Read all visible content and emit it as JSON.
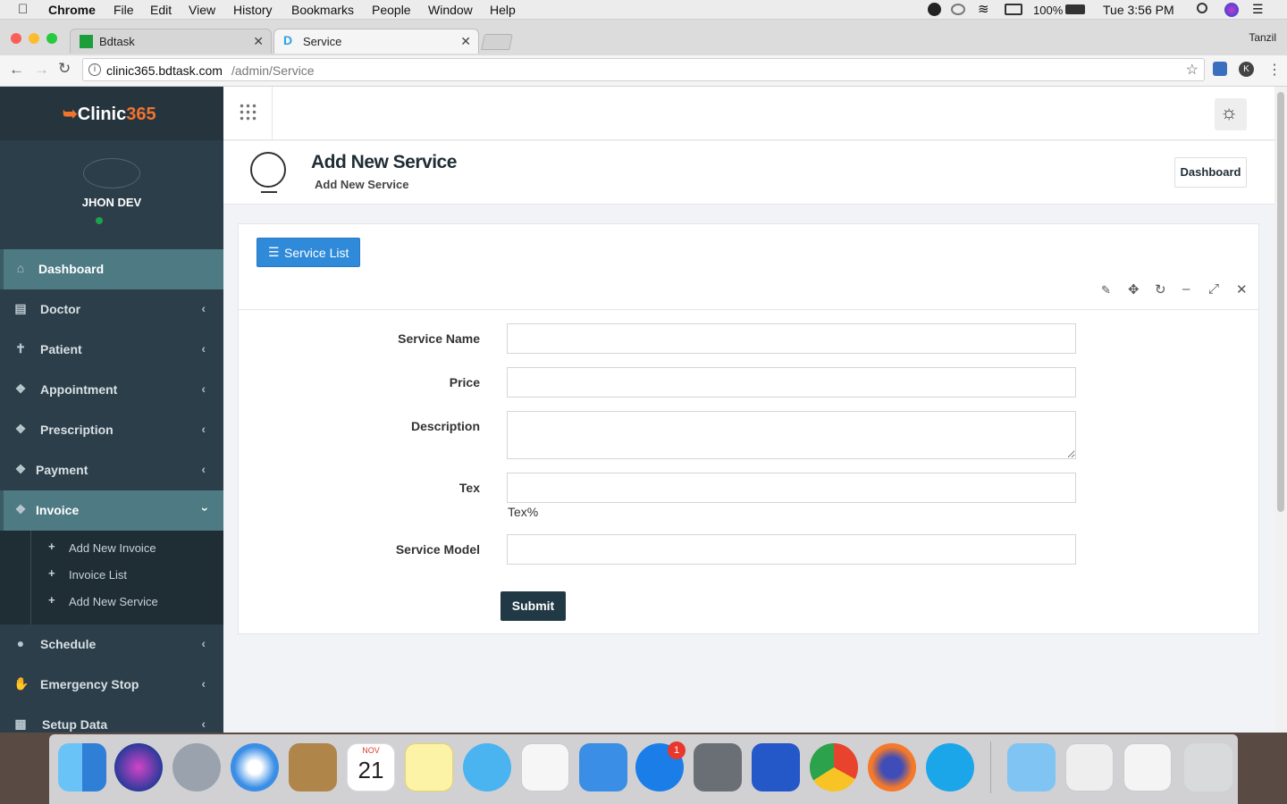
{
  "menubar": {
    "app": "Chrome",
    "items": [
      "File",
      "Edit",
      "View",
      "History",
      "Bookmarks",
      "People",
      "Window",
      "Help"
    ],
    "battery": "100%",
    "clock": "Tue 3:56 PM"
  },
  "browser": {
    "tabs": [
      {
        "title": "Bdtask"
      },
      {
        "title": "Service"
      }
    ],
    "profile_name": "Tanzil",
    "url_host": "clinic365.bdtask.com",
    "url_path": "/admin/Service"
  },
  "sidebar": {
    "logo_text_a": "Clinic",
    "logo_text_b": "365",
    "user_name": "JHON DEV",
    "items": [
      {
        "label": "Dashboard"
      },
      {
        "label": "Doctor"
      },
      {
        "label": "Patient"
      },
      {
        "label": "Appointment"
      },
      {
        "label": "Prescription"
      },
      {
        "label": "Payment"
      },
      {
        "label": "Invoice"
      },
      {
        "label": "Schedule"
      },
      {
        "label": "Emergency Stop"
      },
      {
        "label": "Setup Data"
      }
    ],
    "invoice_sub": [
      {
        "label": "Add New Invoice"
      },
      {
        "label": "Invoice List"
      },
      {
        "label": "Add New Service"
      }
    ]
  },
  "page": {
    "title": "Add New Service",
    "subtitle": "Add New Service",
    "breadcrumb": "Dashboard"
  },
  "panel": {
    "service_list_button": "Service List",
    "tools": [
      "pencil-icon",
      "move-icon",
      "refresh-icon",
      "minimize-icon",
      "expand-icon",
      "close-icon"
    ]
  },
  "form": {
    "service_name_label": "Service Name",
    "price_label": "Price",
    "description_label": "Description",
    "tex_label": "Tex",
    "tex_help": "Tex%",
    "service_model_label": "Service Model",
    "submit_label": "Submit",
    "service_name_value": "",
    "price_value": "",
    "description_value": "",
    "tex_value": "",
    "service_model_value": ""
  },
  "dock": {
    "calendar_month": "NOV",
    "calendar_day": "21",
    "appstore_badge": "1"
  },
  "colors": {
    "sidebar_bg": "#2c3e4a",
    "sidebar_active": "#4e7a83",
    "primary_button": "#2f8ad9",
    "submit_button": "#213945",
    "logo_accent": "#f0742e"
  }
}
